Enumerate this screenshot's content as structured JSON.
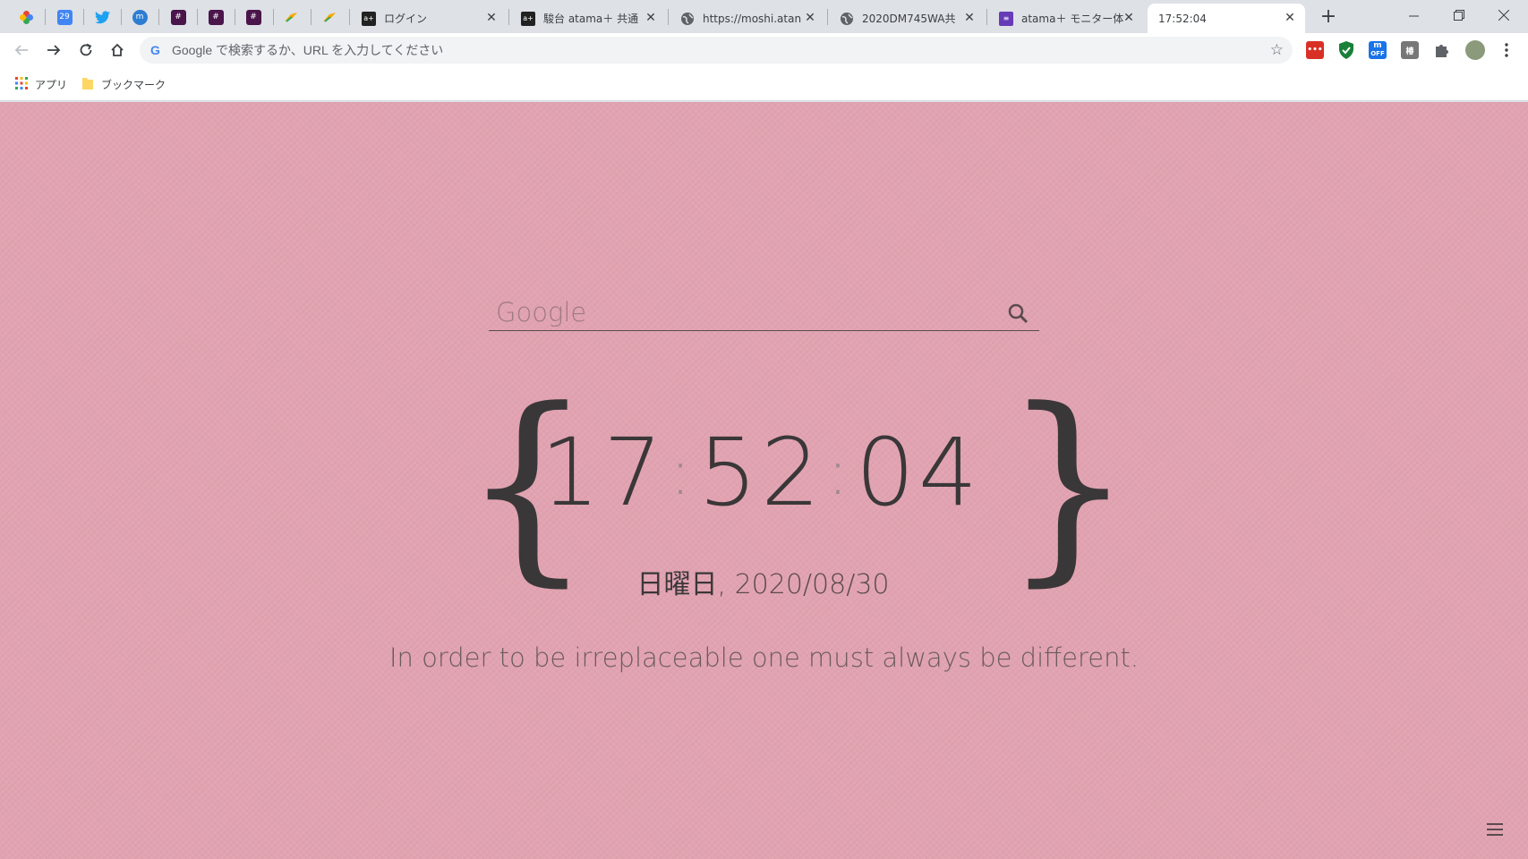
{
  "tabs": {
    "pinned": [
      {
        "icon": "photos-pinwheel-icon",
        "color": "#ea4335"
      },
      {
        "icon": "calendar-icon",
        "color": "#4285f4",
        "text": "29"
      },
      {
        "icon": "twitter-bird-icon",
        "color": "#1da1f2"
      },
      {
        "icon": "m-app-icon",
        "color": "#2d7dd2"
      },
      {
        "icon": "slack-icon",
        "color": "#4a154b"
      },
      {
        "icon": "slack-icon",
        "color": "#4a154b"
      },
      {
        "icon": "slack-icon",
        "color": "#4a154b"
      },
      {
        "icon": "feather-icon",
        "color": "#f9ab00"
      },
      {
        "icon": "feather-icon",
        "color": "#f9ab00"
      }
    ],
    "open": [
      {
        "icon": "atama-plus-icon",
        "title": "ログイン"
      },
      {
        "icon": "atama-plus-icon",
        "title": "駿台 atama＋ 共通"
      },
      {
        "icon": "globe-icon",
        "title": "https://moshi.atan"
      },
      {
        "icon": "globe-icon",
        "title": "2020DM745WA共"
      },
      {
        "icon": "forms-icon",
        "title": "atama＋ モニター体"
      },
      {
        "icon": "none",
        "title": "17:52:04"
      }
    ]
  },
  "toolbar": {
    "omnibox_placeholder": "Google で検索するか、URL を入力してください",
    "extensions": [
      {
        "icon": "red-extension-icon",
        "color": "#d93025",
        "text": "•••"
      },
      {
        "icon": "shield-check-icon",
        "color": "#188038"
      },
      {
        "icon": "m-off-icon",
        "color": "#1a73e8",
        "text": "m"
      },
      {
        "icon": "kanji-extension-icon",
        "color": "#777777",
        "text": "椿"
      },
      {
        "icon": "puzzle-icon",
        "color": "#5f6368"
      },
      {
        "icon": "profile-avatar-icon",
        "color": "#8a9a7a"
      }
    ]
  },
  "bookmarks": {
    "apps_label": "アプリ",
    "folder_label": "ブックマーク"
  },
  "page": {
    "search_placeholder": "Google",
    "clock": {
      "hours": "17",
      "minutes": "52",
      "seconds": "04"
    },
    "day": "日曜日",
    "date": "2020/08/30",
    "quote": "In order to be irreplaceable one must always be different."
  }
}
